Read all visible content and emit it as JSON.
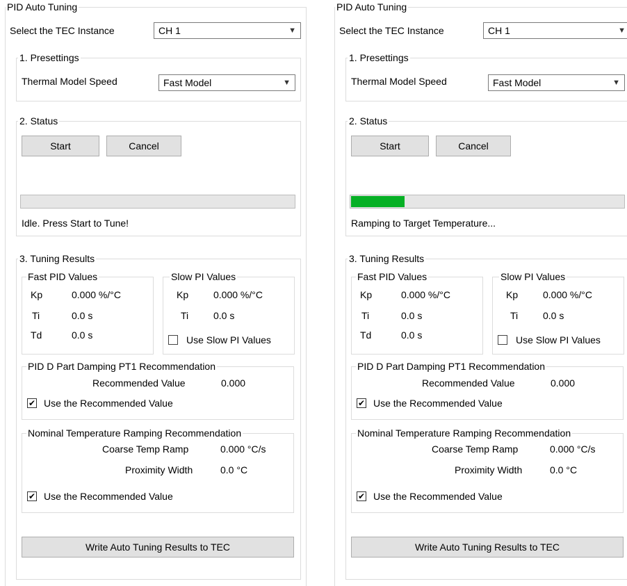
{
  "panels": [
    {
      "title": "PID Auto Tuning",
      "tec_instance_label": "Select the TEC Instance",
      "tec_instance_value": "CH 1",
      "presettings": {
        "title": "1. Presettings",
        "speed_label": "Thermal Model Speed",
        "speed_value": "Fast Model"
      },
      "status": {
        "title": "2. Status",
        "start_label": "Start",
        "cancel_label": "Cancel",
        "progress": 0,
        "message": "Idle. Press Start to Tune!"
      },
      "results": {
        "title": "3. Tuning Results",
        "fast": {
          "title": "Fast PID Values",
          "kp_label": "Kp",
          "kp_value": "0.000 %/°C",
          "ti_label": "Ti",
          "ti_value": "0.0 s",
          "td_label": "Td",
          "td_value": "0.0 s"
        },
        "slow": {
          "title": "Slow PI Values",
          "kp_label": "Kp",
          "kp_value": "0.000 %/°C",
          "ti_label": "Ti",
          "ti_value": "0.0 s",
          "use_label": "Use Slow PI Values",
          "use_checked": false
        },
        "damping": {
          "title": "PID D Part Damping PT1 Recommendation",
          "rec_label": "Recommended Value",
          "rec_value": "0.000",
          "use_label": "Use the Recommended Value",
          "use_checked": true
        },
        "ramping": {
          "title": "Nominal Temperature Ramping Recommendation",
          "coarse_label": "Coarse Temp Ramp",
          "coarse_value": "0.000 °C/s",
          "prox_label": "Proximity Width",
          "prox_value": "0.0 °C",
          "use_label": "Use the Recommended Value",
          "use_checked": true
        }
      },
      "write_label": "Write Auto Tuning Results to TEC"
    },
    {
      "title": "PID Auto Tuning",
      "tec_instance_label": "Select the TEC Instance",
      "tec_instance_value": "CH 1",
      "presettings": {
        "title": "1. Presettings",
        "speed_label": "Thermal Model Speed",
        "speed_value": "Fast Model"
      },
      "status": {
        "title": "2. Status",
        "start_label": "Start",
        "cancel_label": "Cancel",
        "progress": 20,
        "message": "Ramping to Target Temperature..."
      },
      "results": {
        "title": "3. Tuning Results",
        "fast": {
          "title": "Fast PID Values",
          "kp_label": "Kp",
          "kp_value": "0.000 %/°C",
          "ti_label": "Ti",
          "ti_value": "0.0 s",
          "td_label": "Td",
          "td_value": "0.0 s"
        },
        "slow": {
          "title": "Slow PI Values",
          "kp_label": "Kp",
          "kp_value": "0.000 %/°C",
          "ti_label": "Ti",
          "ti_value": "0.0 s",
          "use_label": "Use Slow PI Values",
          "use_checked": false
        },
        "damping": {
          "title": "PID D Part Damping PT1 Recommendation",
          "rec_label": "Recommended Value",
          "rec_value": "0.000",
          "use_label": "Use the Recommended Value",
          "use_checked": true
        },
        "ramping": {
          "title": "Nominal Temperature Ramping Recommendation",
          "coarse_label": "Coarse Temp Ramp",
          "coarse_value": "0.000 °C/s",
          "prox_label": "Proximity Width",
          "prox_value": "0.0 °C",
          "use_label": "Use the Recommended Value",
          "use_checked": true
        }
      },
      "write_label": "Write Auto Tuning Results to TEC"
    }
  ],
  "colors": {
    "progress_fill": "#06b025",
    "group_border": "#dcdcdc",
    "button_face": "#e1e1e1"
  }
}
